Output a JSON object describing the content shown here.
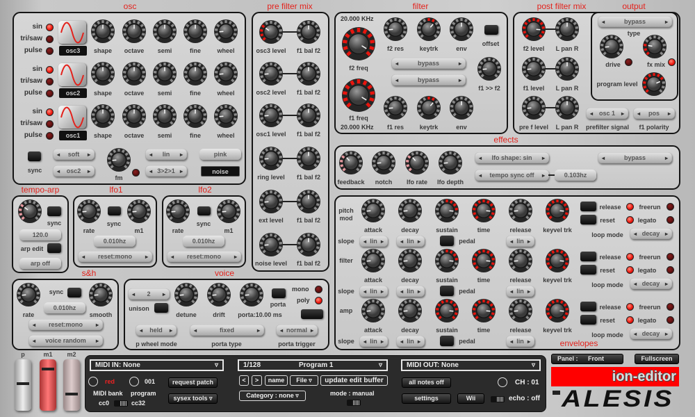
{
  "osc": {
    "title": "osc",
    "wave_options": [
      "sin",
      "tri/saw",
      "pulse"
    ],
    "rows": [
      {
        "name": "osc3",
        "selected_wave": "sin",
        "knobs": [
          {
            "label": "shape",
            "value": 0.5
          },
          {
            "label": "octave",
            "value": 0.5
          },
          {
            "label": "semi",
            "value": 0.5
          },
          {
            "label": "fine",
            "value": 0.5
          },
          {
            "label": "wheel",
            "value": 0.15
          }
        ]
      },
      {
        "name": "osc2",
        "selected_wave": "sin",
        "knobs": [
          {
            "label": "shape",
            "value": 0.5
          },
          {
            "label": "octave",
            "value": 0.5
          },
          {
            "label": "semi",
            "value": 0.5
          },
          {
            "label": "fine",
            "value": 0.5
          },
          {
            "label": "wheel",
            "value": 0.15
          }
        ]
      },
      {
        "name": "osc1",
        "selected_wave": "sin",
        "knobs": [
          {
            "label": "shape",
            "value": 0.5
          },
          {
            "label": "octave",
            "value": 0.5
          },
          {
            "label": "semi",
            "value": 0.5
          },
          {
            "label": "fine",
            "value": 0.5
          },
          {
            "label": "wheel",
            "value": 0.15
          }
        ]
      }
    ],
    "sync_label": "sync",
    "sync_mode": "soft",
    "sync_source": "osc2",
    "fm": {
      "label": "fm",
      "value": 0.15,
      "led_on": false
    },
    "fm_curve": "lin",
    "fm_order": "3>2>1",
    "noise_color": "pink",
    "noise_label": "noise"
  },
  "prefilter": {
    "title": "pre filter mix",
    "rows": [
      {
        "level": {
          "label": "osc3 level",
          "value": 0.3,
          "lit": "fill"
        },
        "bal": {
          "label": "f1 bal f2",
          "value": 0.5
        }
      },
      {
        "level": {
          "label": "osc2 level",
          "value": 0.15
        },
        "bal": {
          "label": "f1 bal f2",
          "value": 0.5
        }
      },
      {
        "level": {
          "label": "osc1 level",
          "value": 0.15
        },
        "bal": {
          "label": "f1 bal f2",
          "value": 0.5
        }
      },
      {
        "level": {
          "label": "ring level",
          "value": 0.15
        },
        "bal": {
          "label": "f1 bal f2",
          "value": 0.5
        }
      },
      {
        "level": {
          "label": "ext level",
          "value": 0.15
        },
        "bal": {
          "label": "f1 bal f2",
          "value": 0.5
        }
      },
      {
        "level": {
          "label": "noise level",
          "value": 0.15
        },
        "bal": {
          "label": "f1 bal f2",
          "value": 0.5
        }
      }
    ]
  },
  "filter": {
    "title": "filter",
    "f2_freq_readout": "20.000 KHz",
    "f1_freq_readout": "20.000 KHz",
    "f2_freq": {
      "label": "f2 freq",
      "value": 0.95,
      "lit": "full"
    },
    "f1_freq": {
      "label": "f1 freq",
      "value": 0.95,
      "lit": "full"
    },
    "f2_res": {
      "label": "f2 res",
      "value": 0.15
    },
    "f2_keytrk": {
      "label": "keytrk",
      "value": 0.65,
      "lit": "bipolar"
    },
    "f2_env": {
      "label": "env",
      "value": 0.5
    },
    "f1_res": {
      "label": "f1 res",
      "value": 0.15
    },
    "f1_keytrk": {
      "label": "keytrk",
      "value": 0.65,
      "lit": "bipolar"
    },
    "f1_env": {
      "label": "env",
      "value": 0.5
    },
    "offset_label": "offset",
    "f2_type": "bypass",
    "f1_type": "bypass",
    "f1_to_f2": {
      "label": "f1 >> f2",
      "value": 0.15
    }
  },
  "postfilter": {
    "title": "post filter mix",
    "rows": [
      {
        "level": {
          "label": "f2 level",
          "value": 0.85,
          "lit": "full"
        },
        "pan": {
          "label": "L pan R",
          "value": 0.5
        }
      },
      {
        "level": {
          "label": "f1 level",
          "value": 0.15
        },
        "pan": {
          "label": "L pan R",
          "value": 0.5
        }
      },
      {
        "level": {
          "label": "pre f level",
          "value": 0.15
        },
        "pan": {
          "label": "L pan R",
          "value": 0.5
        }
      }
    ],
    "prefilter_signal": {
      "value": "osc 1",
      "label": "prefilter signal"
    },
    "f1_polarity": {
      "value": "pos",
      "label": "f1 polarity"
    }
  },
  "output": {
    "title": "output",
    "type_value": "bypass",
    "type_label": "type",
    "drive": {
      "label": "drive",
      "value": 0.15,
      "led_on": false
    },
    "fx_mix": {
      "label": "fx mix",
      "value": 0.2,
      "lit": "fill",
      "led_on": true
    },
    "program_level": {
      "label": "program level",
      "value": 0.75,
      "lit": "fill"
    }
  },
  "effects": {
    "title": "effects",
    "knobs": [
      {
        "label": "feedback",
        "value": 0.35,
        "lit": "pink"
      },
      {
        "label": "notch",
        "value": 0.15
      },
      {
        "label": "lfo rate",
        "value": 0.35,
        "lit": "pink"
      },
      {
        "label": "lfo depth",
        "value": 0.15
      }
    ],
    "lfo_shape": "lfo shape: sin",
    "tempo_sync": "tempo sync off",
    "rate_readout": "0.103hz",
    "type": "bypass"
  },
  "tempo_arp": {
    "title": "tempo-arp",
    "knob": {
      "value": 0.3,
      "lit": "pink"
    },
    "sync_label": "sync",
    "tempo": "120.0",
    "arp_edit_label": "arp edit",
    "arp_mode": "arp off"
  },
  "lfo1": {
    "title": "lfo1",
    "rate": {
      "label": "rate",
      "value": 0.15
    },
    "sync_label": "sync",
    "m1": {
      "label": "m1",
      "value": 0.15
    },
    "rate_readout": "0.010hz",
    "reset": "reset:mono"
  },
  "lfo2": {
    "title": "lfo2",
    "rate": {
      "label": "rate",
      "value": 0.15
    },
    "sync_label": "sync",
    "m1": {
      "label": "m1",
      "value": 0.15
    },
    "rate_readout": "0.010hz",
    "reset": "reset:mono"
  },
  "sh": {
    "title": "s&h",
    "rate": {
      "label": "rate",
      "value": 0.15
    },
    "sync_label": "sync",
    "smooth": {
      "label": "smooth",
      "value": 0.15
    },
    "rate_readout": "0.010hz",
    "reset": "reset:mono",
    "mode": "voice random"
  },
  "voice": {
    "title": "voice",
    "unison_voices": "2",
    "unison_label": "unison",
    "detune": {
      "label": "detune",
      "value": 0.15
    },
    "drift": {
      "label": "drift",
      "value": 0.15
    },
    "porta": {
      "label": "porta:10.00 ms",
      "value": 0.15
    },
    "porta_button_label": "porta",
    "mono_label": "mono",
    "mono_on": false,
    "poly_label": "poly",
    "poly_on": true,
    "p_wheel_mode": {
      "value": "held",
      "label": "p wheel mode"
    },
    "porta_type": {
      "value": "fixed",
      "label": "porta type"
    },
    "porta_trigger": {
      "value": "normal",
      "label": "porta trigger"
    }
  },
  "envelopes": {
    "title": "envelopes",
    "slope_label": "slope",
    "pedal_label": "pedal",
    "loop_mode_label": "loop mode",
    "release_label": "release",
    "reset_label": "reset",
    "freerun_label": "freerun",
    "legato_label": "legato",
    "rows": [
      {
        "name_line1": "pitch",
        "name_line2": "mod",
        "attack": {
          "label": "attack",
          "value": 0.15
        },
        "decay": {
          "label": "decay",
          "value": 0.15
        },
        "sustain": {
          "label": "sustain",
          "value": 0.85,
          "lit": "bipolar"
        },
        "time": {
          "label": "time",
          "value": 0.85,
          "lit": "full"
        },
        "release": {
          "label": "release",
          "value": 0.15
        },
        "keyvel": {
          "label": "keyvel trk",
          "value": 0.85,
          "lit": "full"
        },
        "attack_slope": "lin",
        "decay_slope": "lin",
        "release_slope": "lin",
        "loop_mode": "decay",
        "release_led": true,
        "reset_led": true,
        "freerun_led": false,
        "legato_led": false
      },
      {
        "name_line1": "filter",
        "name_line2": "",
        "attack": {
          "label": "attack",
          "value": 0.15
        },
        "decay": {
          "label": "decay",
          "value": 0.15
        },
        "sustain": {
          "label": "sustain",
          "value": 0.85,
          "lit": "bipolar"
        },
        "time": {
          "label": "time",
          "value": 0.85,
          "lit": "full"
        },
        "release": {
          "label": "release",
          "value": 0.15
        },
        "keyvel": {
          "label": "keyvel trk",
          "value": 0.85,
          "lit": "full"
        },
        "attack_slope": "lin",
        "decay_slope": "lin",
        "release_slope": "lin",
        "loop_mode": "decay",
        "release_led": true,
        "reset_led": true,
        "freerun_led": false,
        "legato_led": false
      },
      {
        "name_line1": "amp",
        "name_line2": "",
        "attack": {
          "label": "attack",
          "value": 0.15
        },
        "decay": {
          "label": "decay",
          "value": 0.15
        },
        "sustain": {
          "label": "sustain",
          "value": 0.85,
          "lit": "full"
        },
        "time": {
          "label": "time",
          "value": 0.85,
          "lit": "full"
        },
        "release": {
          "label": "release",
          "value": 0.15
        },
        "keyvel": {
          "label": "keyvel trk",
          "value": 0.85,
          "lit": "full"
        },
        "attack_slope": "lin",
        "decay_slope": "lin",
        "release_slope": "lin",
        "loop_mode": "decay",
        "release_led": true,
        "reset_led": true,
        "freerun_led": false,
        "legato_led": false
      }
    ]
  },
  "wheels": [
    {
      "label": "p",
      "value": 0.55
    },
    {
      "label": "m1",
      "value": 0.9
    },
    {
      "label": "m2",
      "value": 0.3
    }
  ],
  "midi": {
    "midi_in": "MIDI IN:  None",
    "bank_value": "red",
    "program_value": "001",
    "bank_label": "MIDI bank",
    "program_label": "program",
    "cc0": "cc0",
    "cc32": "cc32",
    "request_patch": "request patch",
    "sysex_tools": "sysex tools ▿",
    "program_number": "1/128",
    "program_name": "Program 1",
    "prev": "<",
    "next": ">",
    "name": "name",
    "file": "File ▿",
    "update_edit_buffer": "update edit buffer",
    "category": "Category : none  ▿",
    "mode": "mode : manual",
    "midi_out": "MIDI OUT: None",
    "all_notes_off": "all notes off",
    "channel": "CH : 01",
    "settings": "settings",
    "wii": "Wii",
    "echo": "echo : off",
    "dropdown_arrow": "▿"
  },
  "panel_select": {
    "label": "Panel :",
    "value": "Front"
  },
  "fullscreen": "Fullscreen",
  "brand": {
    "app_name": "ion-editor",
    "logo": "ALESIS",
    "accent": "#ff0000"
  }
}
